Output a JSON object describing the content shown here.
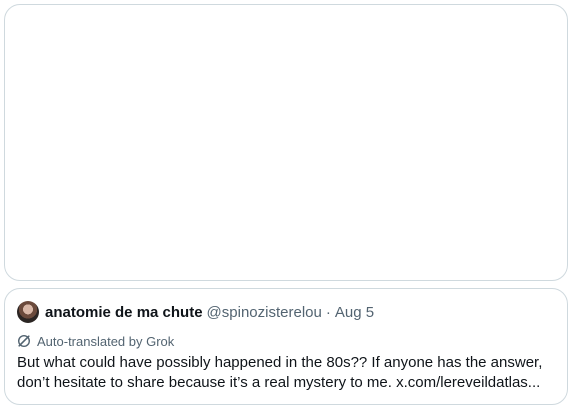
{
  "quoted_tweet": {
    "author_name": "anatomie de ma chute",
    "author_handle": "@spinozisterelou",
    "separator": "·",
    "date": "Aug 5",
    "translation_note": "Auto-translated by Grok",
    "text_line_1": "But what could have possibly happened in the 80s?? If anyone has the answer,",
    "text_line_2": "don’t hesitate to share because it’s a real mystery to me. x.com/lereveildatlas..."
  },
  "colors": {
    "border": "#cfd9de",
    "text_primary": "#0f1419",
    "text_secondary": "#536471"
  },
  "icons": {
    "translation": "grok-icon"
  }
}
